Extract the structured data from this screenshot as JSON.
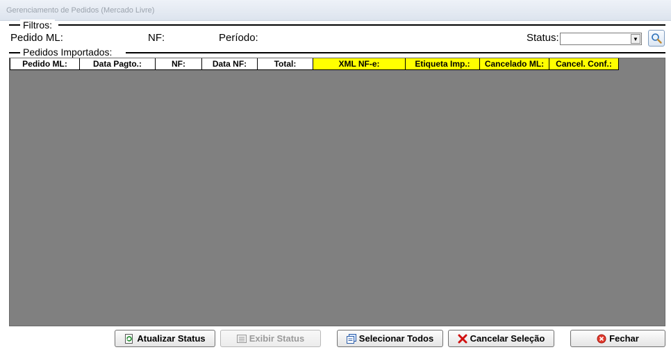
{
  "window": {
    "title": "Gerenciamento de Pedidos (Mercado Livre)"
  },
  "filters": {
    "legend": "Filtros:",
    "pedido_label": "Pedido ML:",
    "pedido_value": "",
    "nf_label": "NF:",
    "nf_value": "",
    "periodo_label": "Período:",
    "periodo_start": "",
    "periodo_end": "",
    "status_label": "Status:",
    "status_value": ""
  },
  "orders": {
    "legend": "Pedidos Importados:",
    "columns": [
      "Pedido ML:",
      "Data Pagto.:",
      "NF:",
      "Data NF:",
      "Total:",
      "XML NF-e:",
      "Etiqueta Imp.:",
      "Cancelado ML:",
      "Cancel. Conf.:"
    ],
    "rows": []
  },
  "buttons": {
    "atualizar": "Atualizar Status",
    "exibir": "Exibir Status",
    "selecionar": "Selecionar Todos",
    "cancelar": "Cancelar Seleção",
    "fechar": "Fechar"
  },
  "colors": {
    "highlight_header": "#ffff00",
    "grid_background": "#808080"
  }
}
